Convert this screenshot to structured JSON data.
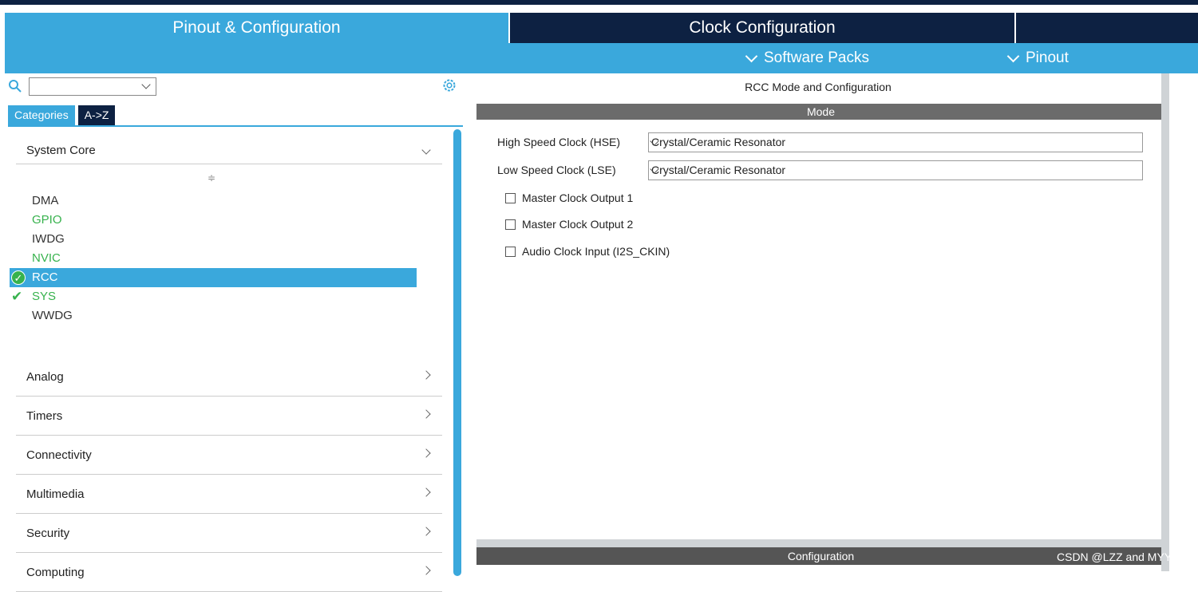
{
  "tabs": {
    "pinout": "Pinout & Configuration",
    "clock": "Clock Configuration"
  },
  "subbar": {
    "software_packs": "Software Packs",
    "pinout": "Pinout"
  },
  "left": {
    "search_value": "",
    "tab_categories": "Categories",
    "tab_az": "A->Z",
    "system_core": "System Core",
    "sort_glyph": "≑",
    "items": [
      {
        "label": "DMA",
        "state": "normal"
      },
      {
        "label": "GPIO",
        "state": "green"
      },
      {
        "label": "IWDG",
        "state": "normal"
      },
      {
        "label": "NVIC",
        "state": "green"
      },
      {
        "label": "RCC",
        "state": "selected-checked"
      },
      {
        "label": "SYS",
        "state": "green-checked"
      },
      {
        "label": "WWDG",
        "state": "normal"
      }
    ],
    "categories": [
      "Analog",
      "Timers",
      "Connectivity",
      "Multimedia",
      "Security",
      "Computing"
    ]
  },
  "right": {
    "title": "RCC Mode and Configuration",
    "mode_header": "Mode",
    "hse_label": "High Speed Clock (HSE)",
    "hse_value": "Crystal/Ceramic Resonator",
    "lse_label": "Low Speed Clock (LSE)",
    "lse_value": "Crystal/Ceramic Resonator",
    "checkboxes": [
      "Master Clock Output 1",
      "Master Clock Output 2",
      "Audio Clock Input (I2S_CKIN)"
    ],
    "config_header": "Configuration"
  },
  "watermark": "CSDN @LZZ and MYY",
  "colors": {
    "accent_blue": "#3aa8dc",
    "navy": "#0d2142",
    "green": "#37b24d",
    "header_gray": "#6b6b6b"
  }
}
